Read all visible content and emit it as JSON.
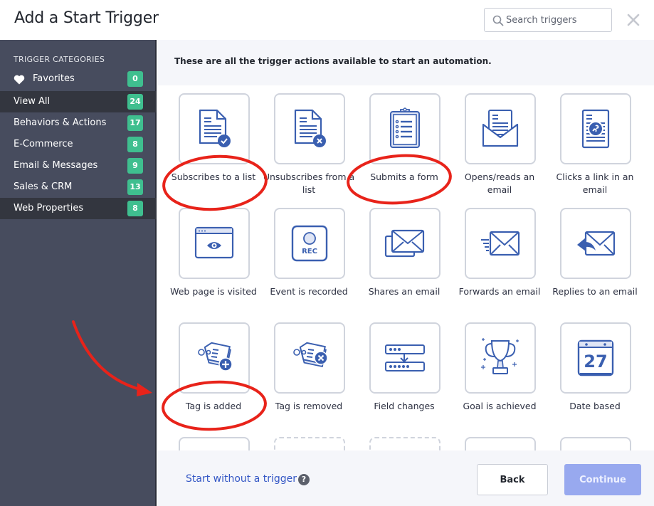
{
  "header": {
    "title": "Add a Start Trigger",
    "search_placeholder": "Search triggers",
    "search_value": "",
    "search_icon": "search-icon",
    "close_icon": "close-icon"
  },
  "sidebar": {
    "heading": "TRIGGER CATEGORIES",
    "items": [
      {
        "label": "Favorites",
        "count": "0",
        "icon": "heart-icon",
        "active": false
      },
      {
        "label": "View All",
        "count": "24",
        "active": true
      },
      {
        "label": "Behaviors & Actions",
        "count": "17",
        "active": false
      },
      {
        "label": "E-Commerce",
        "count": "8",
        "active": false
      },
      {
        "label": "Email & Messages",
        "count": "9",
        "active": false
      },
      {
        "label": "Sales & CRM",
        "count": "13",
        "active": false
      },
      {
        "label": "Web Properties",
        "count": "8",
        "active": true
      }
    ]
  },
  "main": {
    "intro": "These are all the trigger actions available to start an automation.",
    "triggers": [
      {
        "label": "Subscribes to a list",
        "icon": "document-check-icon",
        "highlighted": true
      },
      {
        "label": "Unsubscribes from a list",
        "icon": "document-x-icon",
        "highlighted": false
      },
      {
        "label": "Submits a form",
        "icon": "clipboard-form-icon",
        "highlighted": true
      },
      {
        "label": "Opens/reads an email",
        "icon": "open-envelope-icon",
        "highlighted": false
      },
      {
        "label": "Clicks a link in an email",
        "icon": "document-link-icon",
        "highlighted": false
      },
      {
        "label": "Web page is visited",
        "icon": "browser-eye-icon",
        "highlighted": false
      },
      {
        "label": "Event is recorded",
        "icon": "rec-icon",
        "highlighted": false
      },
      {
        "label": "Shares an email",
        "icon": "envelopes-icon",
        "highlighted": false
      },
      {
        "label": "Forwards an email",
        "icon": "forward-envelope-icon",
        "highlighted": false
      },
      {
        "label": "Replies to an email",
        "icon": "reply-envelope-icon",
        "highlighted": false
      },
      {
        "label": "Tag is added",
        "icon": "tag-add-icon",
        "highlighted": true
      },
      {
        "label": "Tag is removed",
        "icon": "tag-remove-icon",
        "highlighted": false
      },
      {
        "label": "Field changes",
        "icon": "field-change-icon",
        "highlighted": false
      },
      {
        "label": "Goal is achieved",
        "icon": "trophy-icon",
        "highlighted": false
      },
      {
        "label": "Date based",
        "icon": "calendar-icon",
        "highlighted": false
      },
      {
        "label": "",
        "icon": "",
        "partial": true
      },
      {
        "label": "",
        "icon": "",
        "partial": true,
        "dashed": true
      },
      {
        "label": "",
        "icon": "",
        "partial": true,
        "dashed": true
      },
      {
        "label": "",
        "icon": "",
        "partial": true
      },
      {
        "label": "",
        "icon": "",
        "partial": true
      }
    ],
    "calendar_day": "27",
    "rec_text": "REC"
  },
  "footer": {
    "start_without": "Start without a trigger",
    "help_glyph": "?",
    "back_label": "Back",
    "continue_label": "Continue"
  },
  "colors": {
    "sidebar_bg": "#474c5e",
    "sidebar_active": "#33363f",
    "badge": "#3fbf8f",
    "icon_blue": "#3a5fb0",
    "link": "#3457c5",
    "continue_bg": "#98a9ef",
    "annotation_red": "#e8231a"
  }
}
